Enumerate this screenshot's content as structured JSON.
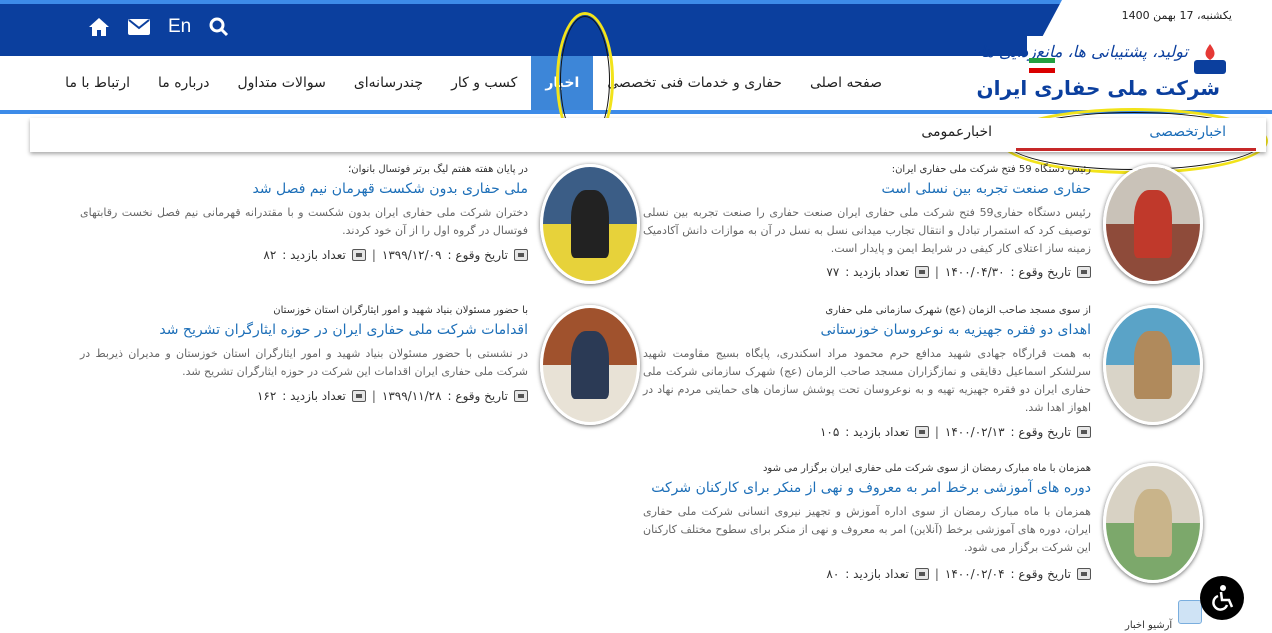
{
  "header": {
    "date": "یکشنبه، 17 بهمن 1400",
    "icons": [
      "home-icon",
      "mail-icon",
      "search-icon"
    ],
    "lang_label": "En",
    "logo_slogan": "تولید، پشتیبانی ها، مانع‌زدایی ها",
    "logo_name": "شرکت ملی حفاری ایران",
    "brand_color": "#0b3f9e",
    "accent_color": "#3d86d8"
  },
  "nav": {
    "items": [
      {
        "label": "صفحه اصلی"
      },
      {
        "label": "حفاری و خدمات فنی تخصصی"
      },
      {
        "label": "اخبار"
      },
      {
        "label": "کسب و کار"
      },
      {
        "label": "چندرسانه‌ای"
      },
      {
        "label": "سوالات متداول"
      },
      {
        "label": "درباره ما"
      },
      {
        "label": "ارتباط با ما"
      }
    ],
    "active_index": 2
  },
  "tabs": {
    "special": "اخبارتخصصی",
    "general": "اخبارعمومی"
  },
  "news_right": [
    {
      "pre": "رئیس دستگاه 59 فتح شرکت ملی حفاری ایران:",
      "title": "حفاری صنعت تجربه بین نسلی است",
      "excerpt": "رئیس دستگاه حفاری59 فتح شرکت ملی حفاری ایران صنعت حفاری را صنعت تجربه بین نسلی توصیف کرد که استمرار تبادل و انتقال تجارب میدانی نسل به نسل در آن به موازات دانش آکادمیک زمینه ساز اعتلای کار کیفی در شرایط ایمن و پایدار است.",
      "date_label": "تاریخ وقوع :",
      "date": "۱۴۰۰/۰۴/۳۰",
      "visits_label": "تعداد بازدید :",
      "visits": "۷۷"
    },
    {
      "pre": "از سوی مسجد صاحب الزمان (عج) شهرک سازمانی ملی حفاری",
      "title": "اهدای دو فقره جهیزیه به نوعروسان خوزستانی",
      "excerpt": "به همت قرارگاه جهادی شهید مدافع حرم محمود مراد اسکندری، پایگاه بسیج مقاومت شهید سرلشکر اسماعیل دقایقی و نمازگزاران مسجد صاحب الزمان (عج) شهرک سازمانی شرکت ملی حفاری ایران دو فقره جهیزیه تهیه و به نوعروسان تحت پوشش سازمان های حمایتی مردم نهاد در اهواز اهدا شد.",
      "date_label": "تاریخ وقوع :",
      "date": "۱۴۰۰/۰۲/۱۳",
      "visits_label": "تعداد بازدید :",
      "visits": "۱۰۵"
    },
    {
      "pre": "همزمان با ماه مبارک رمضان از سوی شرکت ملی حفاری ایران برگزار می شود",
      "title": "دوره های آموزشی برخط امر به معروف و نهی از منکر برای کارکنان شرکت",
      "excerpt": "همزمان با ماه مبارک رمضان از سوی اداره آموزش و تجهیز نیروی انسانی شرکت ملی حفاری ایران، دوره های آموزشی برخط (آنلاین) امر به معروف و نهی از منکر برای سطوح مختلف کارکنان این شرکت برگزار می شود.",
      "date_label": "تاریخ وقوع :",
      "date": "۱۴۰۰/۰۲/۰۴",
      "visits_label": "تعداد بازدید :",
      "visits": "۸۰"
    }
  ],
  "news_left": [
    {
      "pre": "در پایان هفته هفتم لیگ برتر فوتسال بانوان؛",
      "title": "ملی حفاری بدون شکست قهرمان نیم فصل شد",
      "excerpt": "دختران شرکت ملی حفاری ایران بدون شکست و با مقتدرانه قهرمانی نیم فصل نخست رقابتهای فوتسال در گروه اول را از آن خود کردند.",
      "date_label": "تاریخ وقوع :",
      "date": "۱۳۹۹/۱۲/۰۹",
      "visits_label": "تعداد بازدید :",
      "visits": "۸۲"
    },
    {
      "pre": "با حضور مسئولان بنیاد شهید و امور ایثارگران استان خوزستان",
      "title": "اقدامات شرکت ملی حفاری ایران در حوزه ایثارگران تشریح شد",
      "excerpt": "در نشستی با حضور مسئولان بنیاد شهید و امور ایثارگران استان خوزستان و مدیران ذیربط در شرکت ملی حفاری ایران اقدامات این شرکت در حوزه ایثارگران تشریح شد.",
      "date_label": "تاریخ وقوع :",
      "date": "۱۳۹۹/۱۱/۲۸",
      "visits_label": "تعداد بازدید :",
      "visits": "۱۶۲"
    }
  ],
  "archive_label": "آرشیو اخبار",
  "accessibility_icon": "wheelchair-icon"
}
